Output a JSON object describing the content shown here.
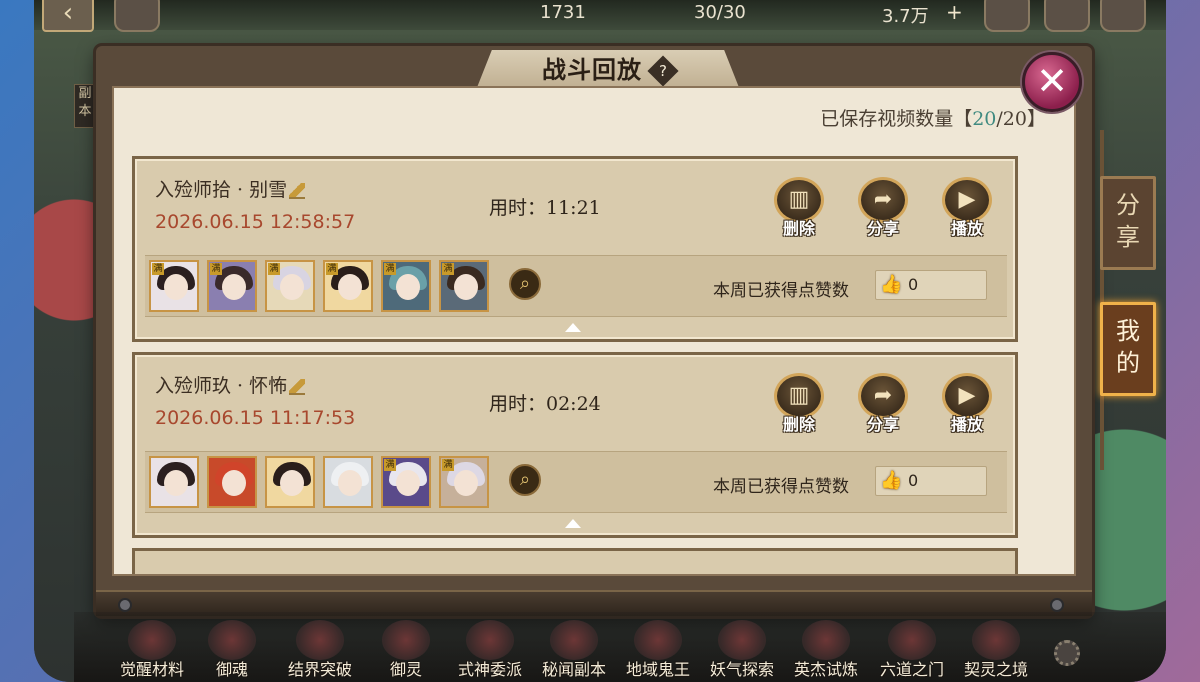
{
  "topbar": {
    "back_icon": "back-arrow-icon",
    "stat_left": "1731",
    "stamina": "30/30",
    "currency": "3.7万",
    "plus": "+"
  },
  "side_left_label": "副本",
  "panel": {
    "title": "战斗回放",
    "help_glyph": "?",
    "close_glyph": "✕",
    "saved_count": {
      "prefix": "已保存视频数量【",
      "current": "20",
      "sep": "/",
      "max": "20",
      "suffix": "】"
    }
  },
  "records": [
    {
      "title": "入殓师拾 · 别雪",
      "time": "2026.06.15 12:58:57",
      "duration": "用时：11:21",
      "actions": {
        "delete": "删除",
        "share": "分享",
        "play": "播放"
      },
      "likes_label": "本周已获得点赞数",
      "likes": "0"
    },
    {
      "title": "入殓师玖 · 怀怖",
      "time": "2026.06.15 11:17:53",
      "duration": "用时：02:24",
      "actions": {
        "delete": "删除",
        "share": "分享",
        "play": "播放"
      },
      "likes_label": "本周已获得点赞数",
      "likes": "0"
    }
  ],
  "avatar_badge": "满",
  "side_tabs": {
    "share": "分享",
    "mine": "我的"
  },
  "dock": [
    "觉醒材料",
    "御魂",
    "结界突破",
    "御灵",
    "式神委派",
    "秘闻副本",
    "地域鬼王",
    "妖气探索",
    "英杰试炼",
    "六道之门",
    "契灵之境"
  ],
  "colors": {
    "accent_time": "#a8482e",
    "saved_current": "#3f8a80",
    "close_button": "#b03a66",
    "active_tab_glow": "#f0a030"
  }
}
